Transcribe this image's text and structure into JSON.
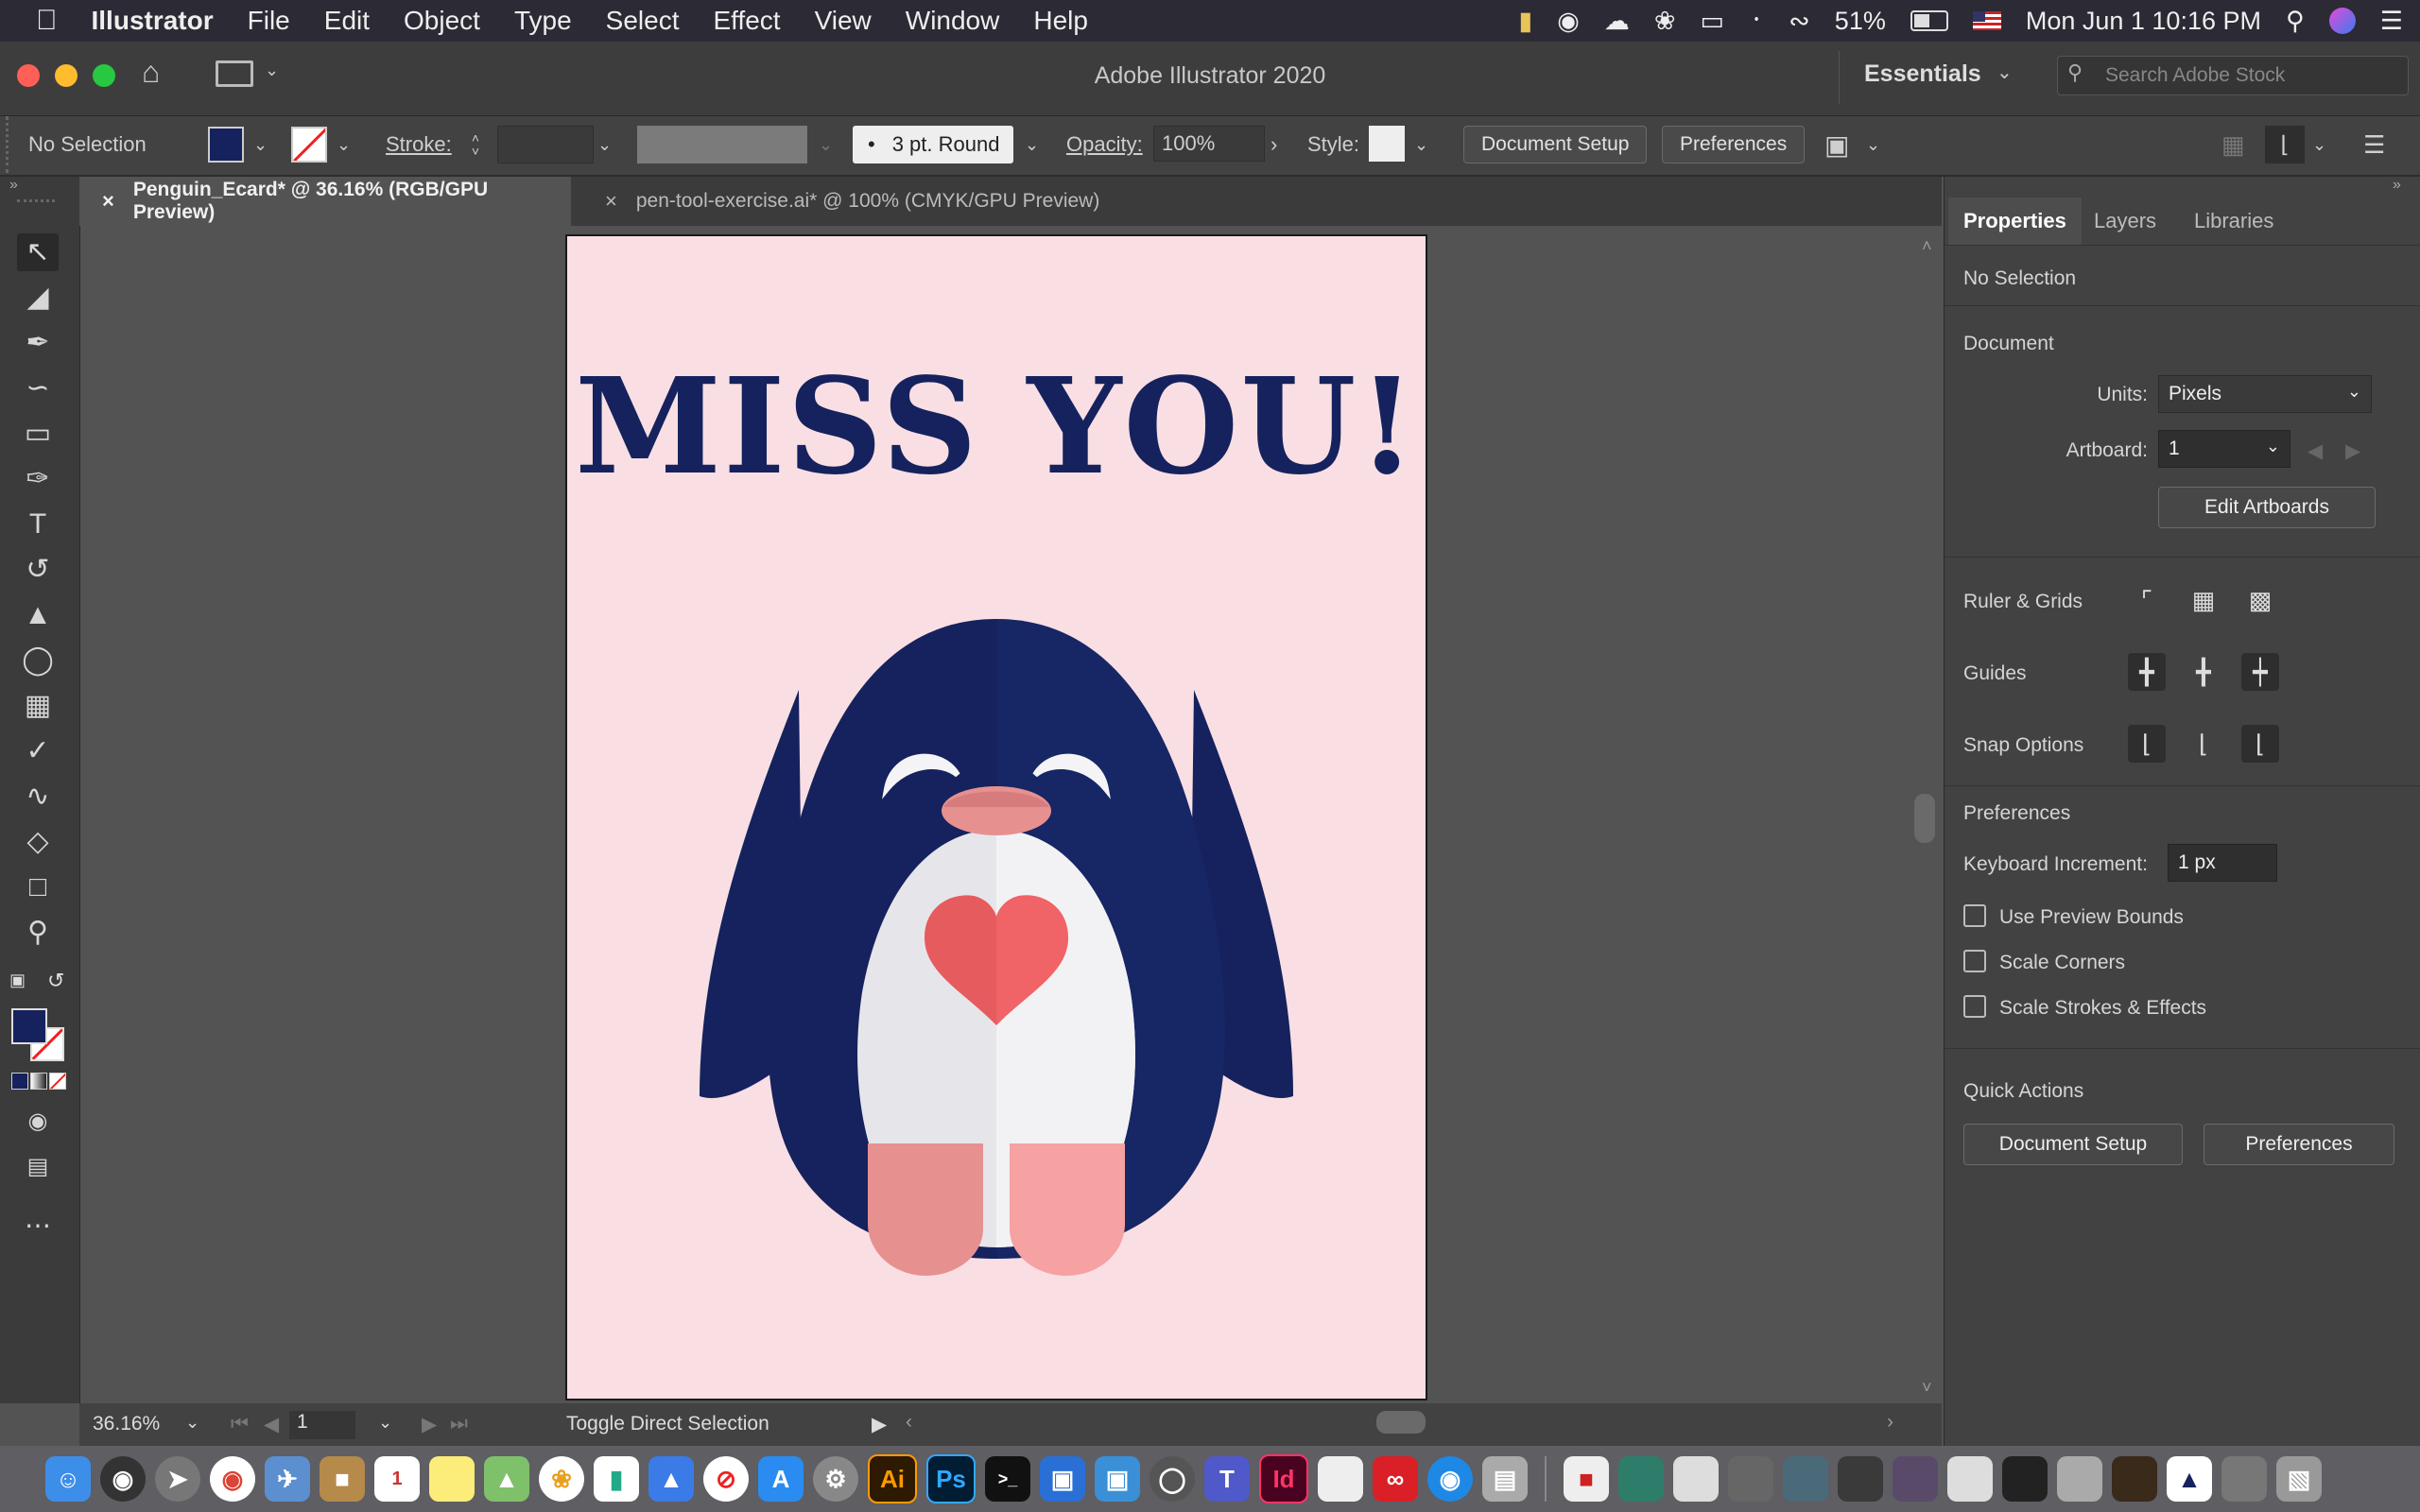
{
  "menubar": {
    "apple": "",
    "app": "Illustrator",
    "items": [
      "File",
      "Edit",
      "Object",
      "Type",
      "Select",
      "Effect",
      "View",
      "Window",
      "Help"
    ],
    "battery": "51%",
    "clock": "Mon Jun 1  10:16 PM"
  },
  "window": {
    "title": "Adobe Illustrator 2020",
    "workspace": "Essentials",
    "search_placeholder": "Search Adobe Stock"
  },
  "controlbar": {
    "selection": "No Selection",
    "stroke_label": "Stroke:",
    "brush": "3 pt. Round",
    "opacity_label": "Opacity:",
    "opacity_value": "100%",
    "style_label": "Style:",
    "document_setup": "Document Setup",
    "preferences": "Preferences"
  },
  "tabs": [
    {
      "label": "Penguin_Ecard* @ 36.16% (RGB/GPU Preview)",
      "active": true
    },
    {
      "label": "pen-tool-exercise.ai* @ 100% (CMYK/GPU Preview)",
      "active": false
    }
  ],
  "artboard": {
    "headline": "MISS YOU!"
  },
  "statusbar": {
    "zoom": "36.16%",
    "artboard_number": "1",
    "tool_hint": "Toggle Direct Selection"
  },
  "panel": {
    "tabs": [
      "Properties",
      "Layers",
      "Libraries"
    ],
    "selection": "No Selection",
    "document_heading": "Document",
    "units_label": "Units:",
    "units_value": "Pixels",
    "artboard_label": "Artboard:",
    "artboard_value": "1",
    "edit_artboards": "Edit Artboards",
    "rulers_label": "Ruler & Grids",
    "guides_label": "Guides",
    "snap_label": "Snap Options",
    "preferences_heading": "Preferences",
    "keyboard_increment_label": "Keyboard Increment:",
    "keyboard_increment_value": "1 px",
    "use_preview_bounds": "Use Preview Bounds",
    "scale_corners": "Scale Corners",
    "scale_strokes": "Scale Strokes & Effects",
    "quick_actions": "Quick Actions",
    "qa_document_setup": "Document Setup",
    "qa_preferences": "Preferences"
  },
  "dock": {
    "illustrator_label": "Ai",
    "photoshop_label": "Ps",
    "indesign_label": "Id"
  },
  "colors": {
    "navy": "#15225e",
    "artboard_pink": "#f9dfe3",
    "belly": "#e6e6ea",
    "heart": "#e65b5e",
    "feet": "#f29a9b",
    "beak": "#e79090"
  }
}
